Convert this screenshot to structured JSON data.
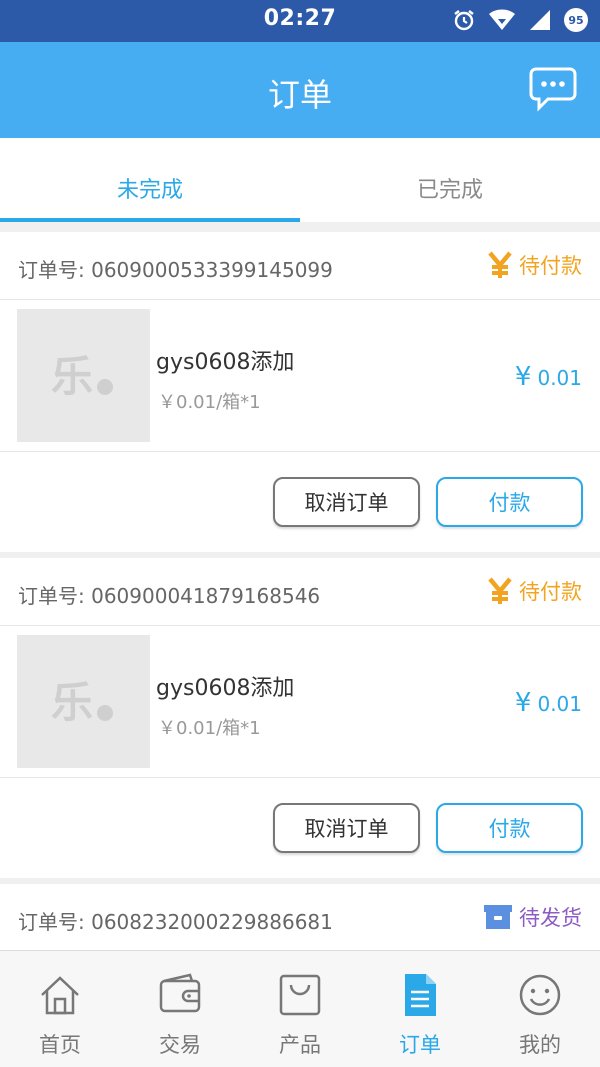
{
  "status_bar": {
    "time": "02:27",
    "battery": "95"
  },
  "header": {
    "title": "订单"
  },
  "tabs": [
    {
      "label": "未完成",
      "active": true
    },
    {
      "label": "已完成",
      "active": false
    }
  ],
  "orders": [
    {
      "order_label": "订单号: 0609000533399145099",
      "status": "待付款",
      "status_icon": "yen-icon",
      "product_name": "gys0608添加",
      "unit_price": "￥0.01/箱*1",
      "total_symbol": "¥",
      "total": "0.01",
      "cancel_label": "取消订单",
      "pay_label": "付款"
    },
    {
      "order_label": "订单号: 060900041879168546",
      "status": "待付款",
      "status_icon": "yen-icon",
      "product_name": "gys0608添加",
      "unit_price": "￥0.01/箱*1",
      "total_symbol": "¥",
      "total": "0.01",
      "cancel_label": "取消订单",
      "pay_label": "付款"
    },
    {
      "order_label": "订单号: 0608232000229886681",
      "status": "待发货",
      "status_icon": "box-icon"
    }
  ],
  "bottom_nav": [
    {
      "label": "首页",
      "icon": "home-icon",
      "active": false
    },
    {
      "label": "交易",
      "icon": "wallet-icon",
      "active": false
    },
    {
      "label": "产品",
      "icon": "bag-icon",
      "active": false
    },
    {
      "label": "订单",
      "icon": "document-icon",
      "active": true
    },
    {
      "label": "我的",
      "icon": "smiley-icon",
      "active": false
    }
  ],
  "colors": {
    "accent": "#2aa8e8",
    "header": "#46adf2",
    "pending_pay": "#f2a421",
    "pending_ship": "#8e5bc2"
  }
}
